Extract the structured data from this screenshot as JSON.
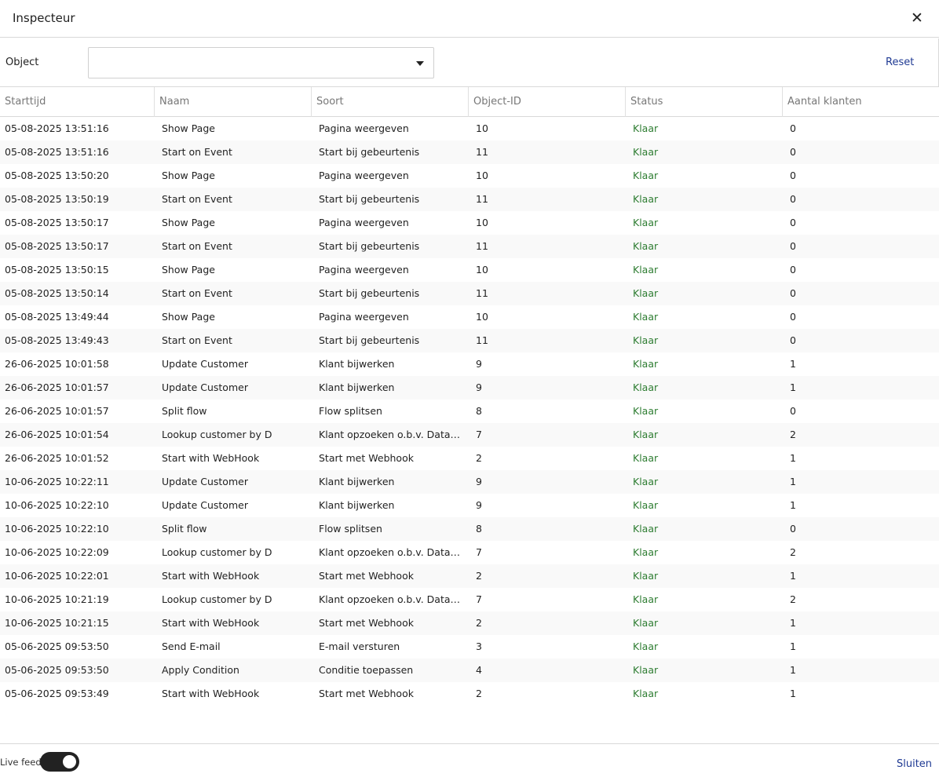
{
  "header": {
    "title": "Inspecteur",
    "close_icon": "close-icon"
  },
  "filter": {
    "label": "Object",
    "value": "",
    "reset_label": "Reset"
  },
  "columns": [
    "Starttijd",
    "Naam",
    "Soort",
    "Object-ID",
    "Status",
    "Aantal klanten"
  ],
  "rows": [
    [
      "05-08-2025 13:51:16",
      "Show Page",
      "Pagina weergeven",
      "10",
      "Klaar",
      "0"
    ],
    [
      "05-08-2025 13:51:16",
      "Start on Event",
      "Start bij gebeurtenis",
      "11",
      "Klaar",
      "0"
    ],
    [
      "05-08-2025 13:50:20",
      "Show Page",
      "Pagina weergeven",
      "10",
      "Klaar",
      "0"
    ],
    [
      "05-08-2025 13:50:19",
      "Start on Event",
      "Start bij gebeurtenis",
      "11",
      "Klaar",
      "0"
    ],
    [
      "05-08-2025 13:50:17",
      "Show Page",
      "Pagina weergeven",
      "10",
      "Klaar",
      "0"
    ],
    [
      "05-08-2025 13:50:17",
      "Start on Event",
      "Start bij gebeurtenis",
      "11",
      "Klaar",
      "0"
    ],
    [
      "05-08-2025 13:50:15",
      "Show Page",
      "Pagina weergeven",
      "10",
      "Klaar",
      "0"
    ],
    [
      "05-08-2025 13:50:14",
      "Start on Event",
      "Start bij gebeurtenis",
      "11",
      "Klaar",
      "0"
    ],
    [
      "05-08-2025 13:49:44",
      "Show Page",
      "Pagina weergeven",
      "10",
      "Klaar",
      "0"
    ],
    [
      "05-08-2025 13:49:43",
      "Start on Event",
      "Start bij gebeurtenis",
      "11",
      "Klaar",
      "0"
    ],
    [
      "26-06-2025 10:01:58",
      "Update Customer",
      "Klant bijwerken",
      "9",
      "Klaar",
      "1"
    ],
    [
      "26-06-2025 10:01:57",
      "Update Customer",
      "Klant bijwerken",
      "9",
      "Klaar",
      "1"
    ],
    [
      "26-06-2025 10:01:57",
      "Split flow",
      "Flow splitsen",
      "8",
      "Klaar",
      "0"
    ],
    [
      "26-06-2025 10:01:54",
      "Lookup customer by D",
      "Klant opzoeken o.b.v. Datam…",
      "7",
      "Klaar",
      "2"
    ],
    [
      "26-06-2025 10:01:52",
      "Start with WebHook",
      "Start met Webhook",
      "2",
      "Klaar",
      "1"
    ],
    [
      "10-06-2025 10:22:11",
      "Update Customer",
      "Klant bijwerken",
      "9",
      "Klaar",
      "1"
    ],
    [
      "10-06-2025 10:22:10",
      "Update Customer",
      "Klant bijwerken",
      "9",
      "Klaar",
      "1"
    ],
    [
      "10-06-2025 10:22:10",
      "Split flow",
      "Flow splitsen",
      "8",
      "Klaar",
      "0"
    ],
    [
      "10-06-2025 10:22:09",
      "Lookup customer by D",
      "Klant opzoeken o.b.v. Datam…",
      "7",
      "Klaar",
      "2"
    ],
    [
      "10-06-2025 10:22:01",
      "Start with WebHook",
      "Start met Webhook",
      "2",
      "Klaar",
      "1"
    ],
    [
      "10-06-2025 10:21:19",
      "Lookup customer by D",
      "Klant opzoeken o.b.v. Datam…",
      "7",
      "Klaar",
      "2"
    ],
    [
      "10-06-2025 10:21:15",
      "Start with WebHook",
      "Start met Webhook",
      "2",
      "Klaar",
      "1"
    ],
    [
      "05-06-2025 09:53:50",
      "Send E-mail",
      "E-mail versturen",
      "3",
      "Klaar",
      "1"
    ],
    [
      "05-06-2025 09:53:50",
      "Apply Condition",
      "Conditie toepassen",
      "4",
      "Klaar",
      "1"
    ],
    [
      "05-06-2025 09:53:49",
      "Start with WebHook",
      "Start met Webhook",
      "2",
      "Klaar",
      "1"
    ]
  ],
  "footer": {
    "live_feed_label": "Live feed",
    "live_feed_on": true,
    "close_label": "Sluiten"
  },
  "colors": {
    "status_done": "#2e7d32",
    "link": "#1f3a93",
    "toggle_on": "#222222"
  }
}
